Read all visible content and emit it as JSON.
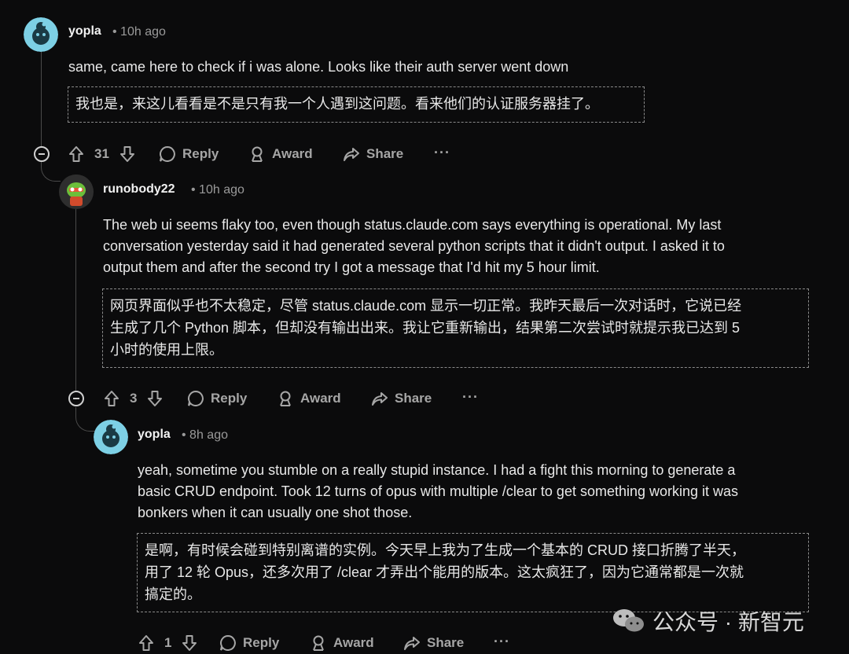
{
  "comments": [
    {
      "username": "yopla",
      "time": "• 10h ago",
      "text": "same, came here to check if i was alone. Looks like their auth server went down",
      "translation": "我也是，来这儿看看是不是只有我一个人遇到这问题。看来他们的认证服务器挂了。",
      "votes": "31"
    },
    {
      "username": "runobody22",
      "time": "• 10h ago",
      "text_lines": [
        "The web ui seems flaky too, even though status.claude.com says everything is operational. My last",
        "conversation yesterday said it had generated several python scripts that it didn't output. I asked it to",
        "output them and after the second try I got a message that I'd hit my 5 hour limit."
      ],
      "translation_lines": [
        "网页界面似乎也不太稳定，尽管 status.claude.com 显示一切正常。我昨天最后一次对话时，它说已经",
        "生成了几个 Python 脚本，但却没有输出出来。我让它重新输出，结果第二次尝试时就提示我已达到 5",
        "小时的使用上限。"
      ],
      "votes": "3"
    },
    {
      "username": "yopla",
      "time": "• 8h ago",
      "text_lines": [
        "yeah, sometime you stumble on a really stupid instance. I had a fight this morning to generate a",
        "basic CRUD endpoint. Took 12 turns of opus with multiple /clear to get something working it was",
        "bonkers when it can usually one shot those."
      ],
      "translation_lines": [
        "是啊，有时候会碰到特别离谱的实例。今天早上我为了生成一个基本的 CRUD 接口折腾了半天，",
        "用了 12 轮 Opus，还多次用了 /clear 才弄出个能用的版本。这太疯狂了，因为它通常都是一次就",
        "搞定的。"
      ],
      "votes": "1"
    }
  ],
  "actions": {
    "reply": "Reply",
    "award": "Award",
    "share": "Share",
    "more": "···"
  },
  "watermark": "公众号 · 新智元",
  "colors": {
    "background": "#0b0b0c",
    "avatar": "#7dd0e5",
    "muted": "#a6a6a6"
  }
}
